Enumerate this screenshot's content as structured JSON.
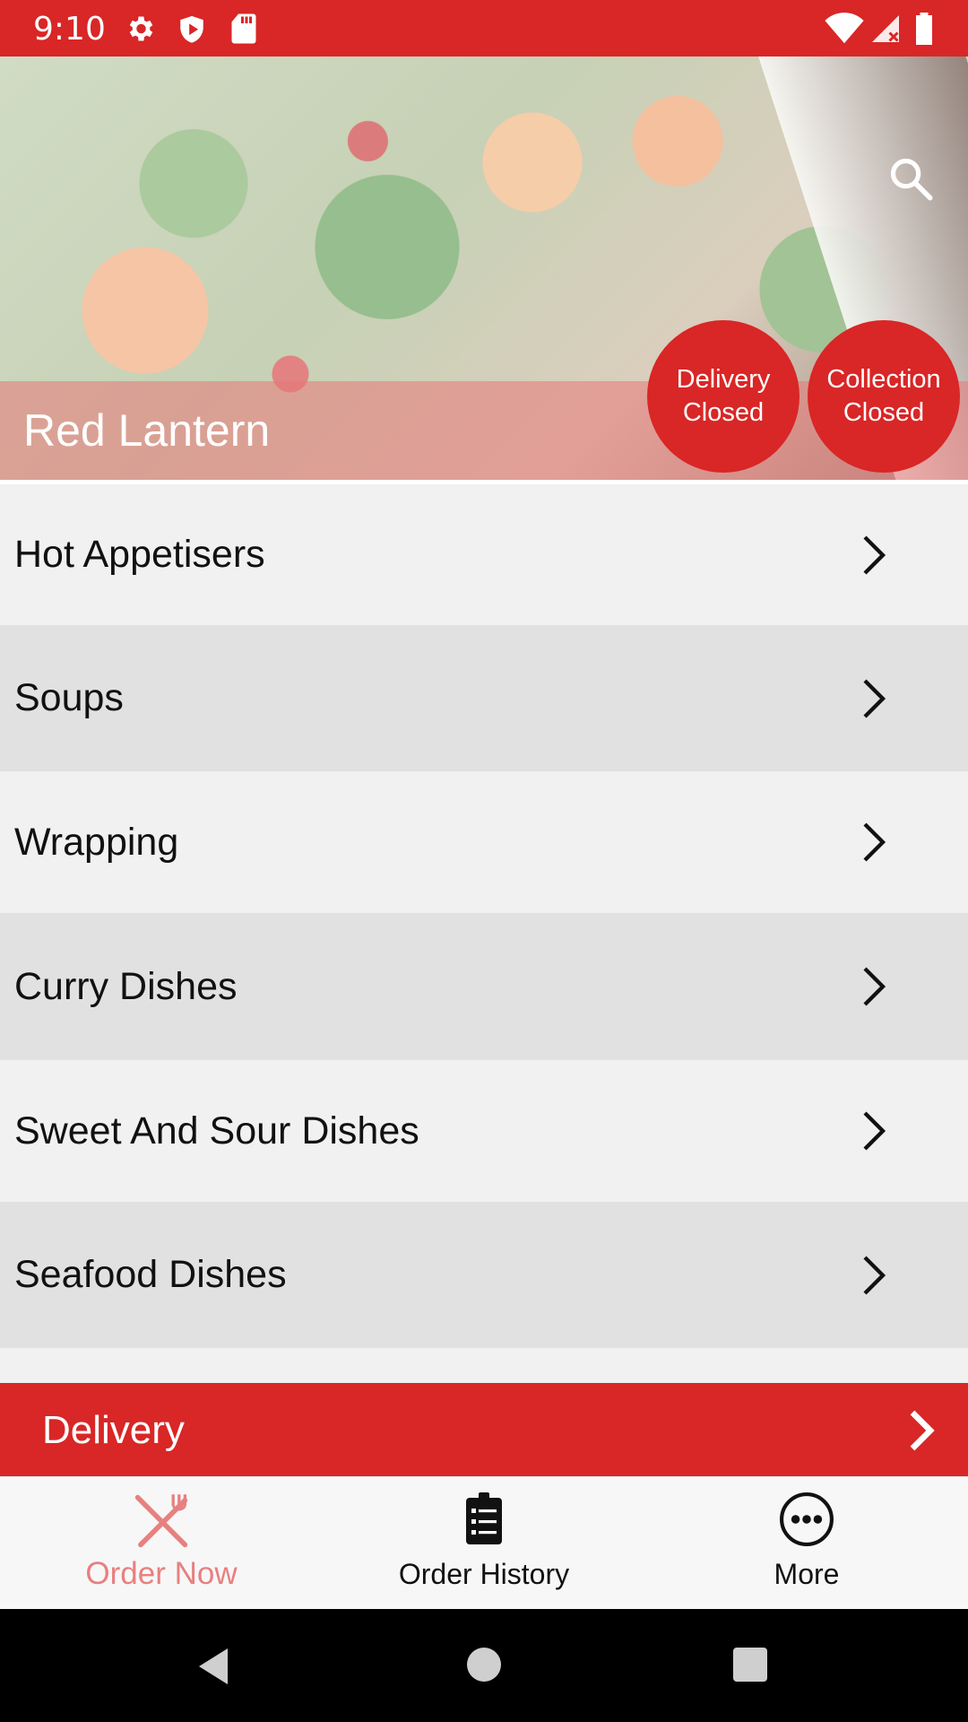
{
  "status_bar": {
    "time": "9:10",
    "icons": [
      "gear-icon",
      "shield-icon",
      "sd-card-icon",
      "wifi-icon",
      "signal-icon",
      "battery-icon"
    ]
  },
  "hero": {
    "title": "Red Lantern",
    "search_icon": "search-icon",
    "badges": {
      "delivery_line1": "Delivery",
      "delivery_line2": "Closed",
      "collection_line1": "Collection",
      "collection_line2": "Closed"
    }
  },
  "menu": {
    "items": [
      {
        "label": "Hot Appetisers"
      },
      {
        "label": "Soups"
      },
      {
        "label": "Wrapping"
      },
      {
        "label": "Curry Dishes"
      },
      {
        "label": "Sweet And Sour Dishes"
      },
      {
        "label": "Seafood Dishes"
      }
    ]
  },
  "delivery_bar": {
    "label": "Delivery"
  },
  "bottom_nav": {
    "order_now": "Order Now",
    "order_history": "Order History",
    "more": "More"
  },
  "colors": {
    "brand_red": "#d92626",
    "active_tab": "#e88080",
    "row_light": "#f1f1f1",
    "row_dark": "#e1e1e1"
  }
}
